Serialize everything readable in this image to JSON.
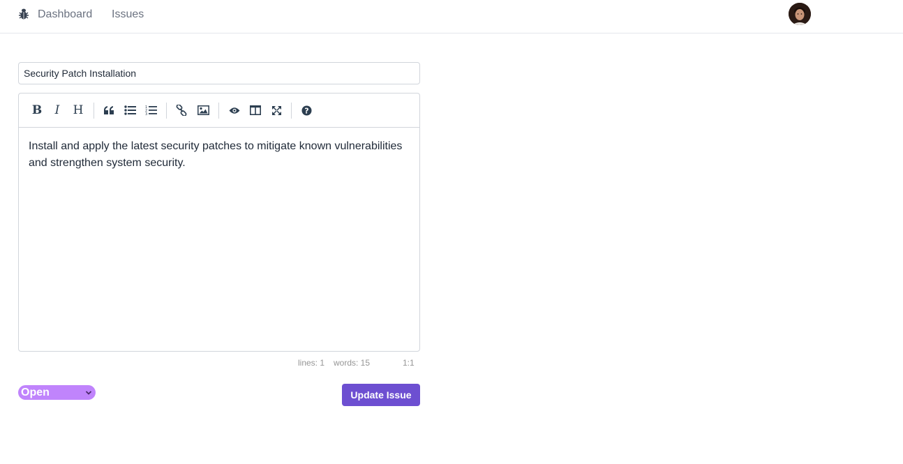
{
  "nav": {
    "logo_icon": "bug-icon",
    "links": [
      "Dashboard",
      "Issues"
    ],
    "avatar_icon": "user-avatar"
  },
  "form": {
    "title_value": "Security Patch Installation",
    "editor": {
      "toolbar": [
        "bold-icon",
        "italic-icon",
        "heading-icon",
        "quote-icon",
        "unordered-list-icon",
        "ordered-list-icon",
        "link-icon",
        "image-icon",
        "preview-icon",
        "side-by-side-icon",
        "fullscreen-icon",
        "help-icon"
      ],
      "content": "Install and apply the latest security patches to mitigate known vulnerabilities and strengthen system security.",
      "status": {
        "lines": "lines: 1",
        "words": "words: 15",
        "cursor": "1:1"
      }
    },
    "status_select": {
      "value": "Open",
      "icon": "chevron-down-icon"
    },
    "submit_label": "Update Issue"
  },
  "colors": {
    "accent": "#6d4fd1",
    "status_open": "#c084fc"
  }
}
